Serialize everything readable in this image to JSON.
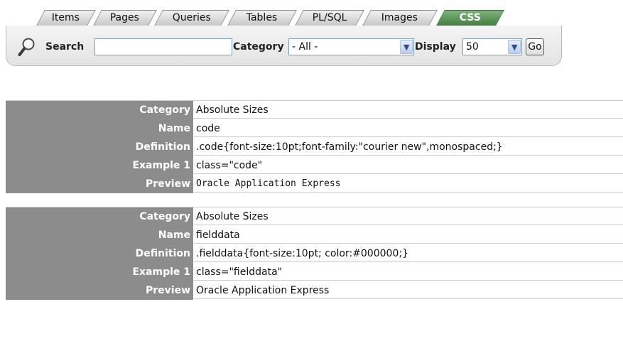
{
  "tabs": [
    {
      "label": "Items",
      "active": false
    },
    {
      "label": "Pages",
      "active": false
    },
    {
      "label": "Queries",
      "active": false
    },
    {
      "label": "Tables",
      "active": false
    },
    {
      "label": "PL/SQL",
      "active": false
    },
    {
      "label": "Images",
      "active": false
    },
    {
      "label": "CSS",
      "active": true
    }
  ],
  "toolbar": {
    "search_icon": "magnifier-icon",
    "search_label": "Search",
    "search_value": "",
    "category_label": "Category",
    "category_selected": "- All -",
    "display_label": "Display",
    "display_selected": "50",
    "go_label": "Go"
  },
  "colors": {
    "label_cell_bg": "#8c8c8c",
    "active_tab": "#4f8a4c",
    "tab_bg": "#d5d5d5"
  },
  "records": [
    {
      "rows": [
        {
          "key": "Category",
          "value": "Absolute Sizes",
          "mono": false
        },
        {
          "key": "Name",
          "value": "code",
          "mono": false
        },
        {
          "key": "Definition",
          "value": ".code{font-size:10pt;font-family:\"courier new\",monospaced;}",
          "mono": false
        },
        {
          "key": "Example 1",
          "value": "class=\"code\"",
          "mono": false
        },
        {
          "key": "Preview",
          "value": "Oracle Application Express",
          "mono": true
        }
      ]
    },
    {
      "rows": [
        {
          "key": "Category",
          "value": "Absolute Sizes",
          "mono": false
        },
        {
          "key": "Name",
          "value": "fielddata",
          "mono": false
        },
        {
          "key": "Definition",
          "value": ".fielddata{font-size:10pt; color:#000000;}",
          "mono": false
        },
        {
          "key": "Example 1",
          "value": "class=\"fielddata\"",
          "mono": false
        },
        {
          "key": "Preview",
          "value": "Oracle Application Express",
          "mono": false
        }
      ]
    }
  ]
}
